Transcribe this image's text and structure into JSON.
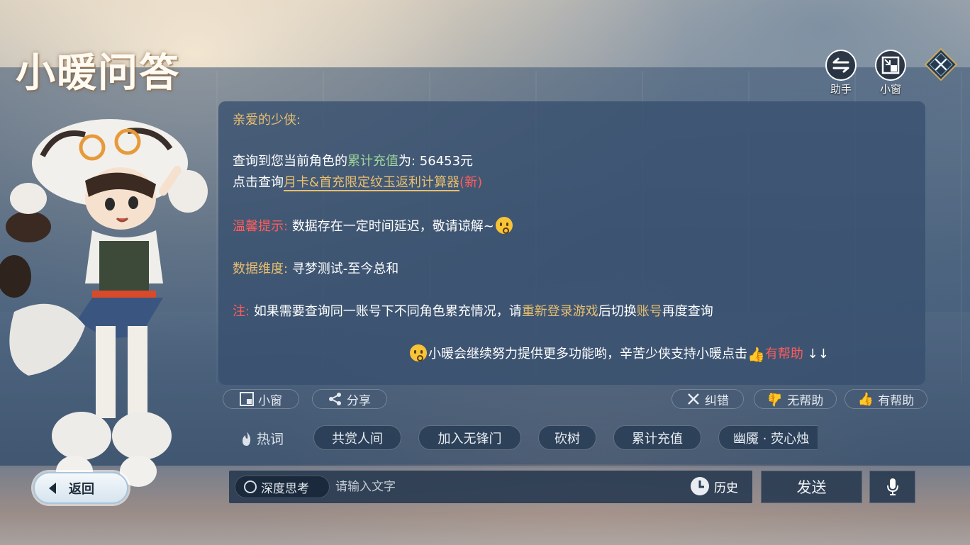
{
  "title": "小暖问答",
  "top_buttons": {
    "assistant_label": "助手",
    "mini_window_label": "小窗"
  },
  "dialog": {
    "greeting": "亲爱的少侠:",
    "line1_prefix": "查询到您当前角色的",
    "line1_highlight": "累计充值",
    "line1_suffix": "为: 56453元",
    "line2_prefix": "点击查询",
    "line2_link": "月卡&首充限定纹玉返利计算器",
    "line2_new": "(新)",
    "tip_label": "温馨提示:",
    "tip_text": "数据存在一定时间延迟，敬请谅解~",
    "dimension_label": "数据维度:",
    "dimension_text": "寻梦测试-至今总和",
    "note_label": "注:",
    "note_text_1": "如果需要查询同一账号下不同角色累充情况，请",
    "note_highlight_1": "重新登录游戏",
    "note_text_2": "后切换",
    "note_highlight_2": "账号",
    "note_text_3": "再度查询",
    "footer_text": "小暖会继续努力提供更多功能哟，辛苦少侠支持小暖点击",
    "footer_helpful": "有帮助",
    "footer_arrows": "↓↓"
  },
  "actions": {
    "mini_window": "小窗",
    "share": "分享",
    "correct": "纠错",
    "unhelpful": "无帮助",
    "helpful": "有帮助"
  },
  "hot_words": {
    "label": "热词",
    "items": [
      "共赏人间",
      "加入无锋门",
      "砍树",
      "累计充值",
      "幽魇 · 荧心烛"
    ]
  },
  "back_button": "返回",
  "input": {
    "deep_think": "深度思考",
    "placeholder": "请输入文字",
    "history": "历史"
  },
  "send_button": "发送",
  "colors": {
    "gold": "#e9bf6f",
    "green": "#9ed49a",
    "red": "#ff5c5c",
    "panel": "#37506e"
  }
}
